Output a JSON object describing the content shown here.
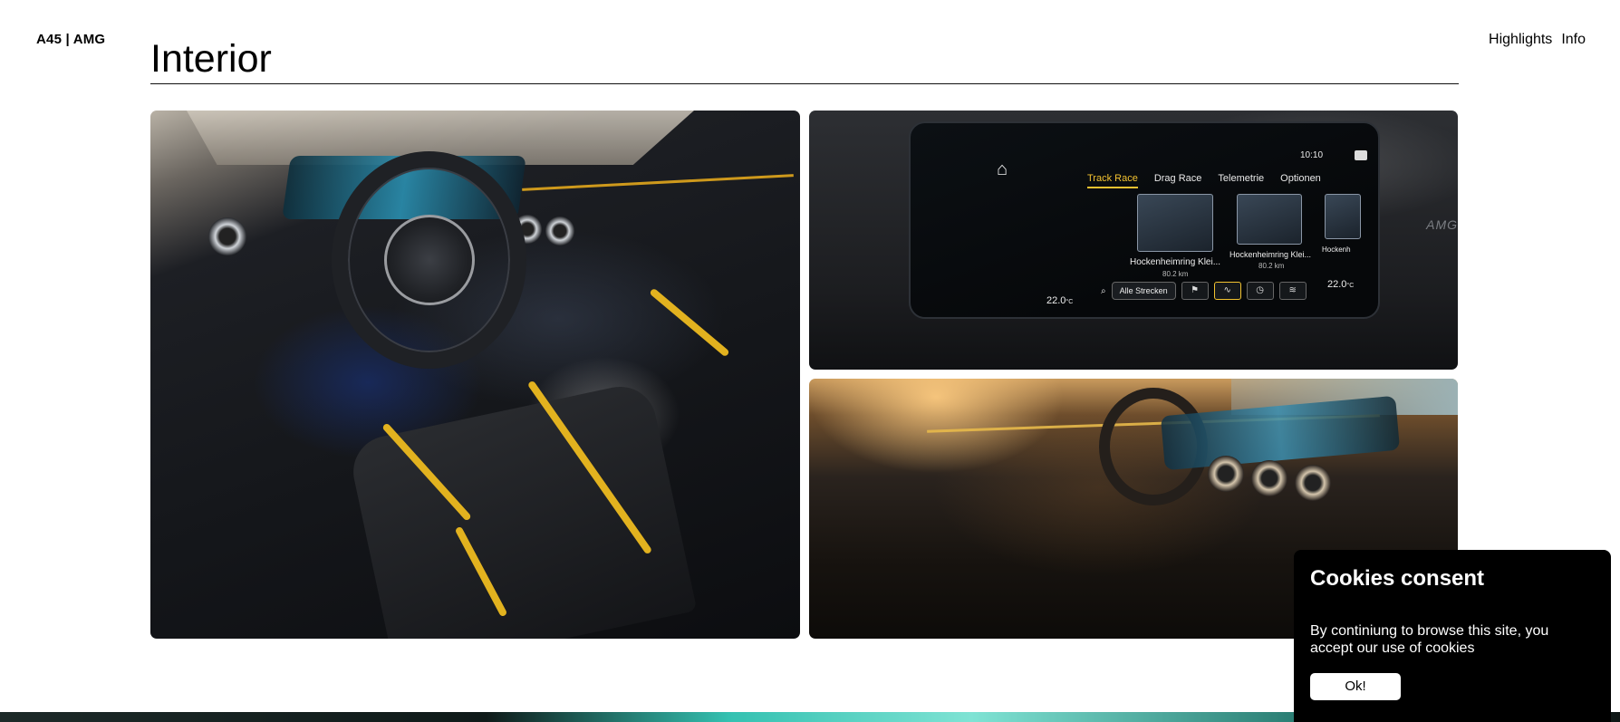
{
  "header": {
    "brand": "A45 | AMG",
    "nav": [
      "Highlights",
      "Info"
    ]
  },
  "section": {
    "title": "Interior"
  },
  "infotainment": {
    "tabs": [
      "Track Race",
      "Drag Race",
      "Telemetrie",
      "Optionen"
    ],
    "active_tab": "Track Race",
    "clock": "10:10",
    "tracks": [
      {
        "name": "Hockenheimring Klei...",
        "distance": "80.2 km"
      },
      {
        "name": "Hockenheimring Klei...",
        "distance": "80.2 km"
      },
      {
        "name": "Hockenh",
        "distance": ""
      }
    ],
    "search_label": "Alle Strecken",
    "temp_left": "22.0",
    "temp_right": "22.0",
    "temp_unit": "°C",
    "badge": "AMG"
  },
  "cookie": {
    "title": "Cookies consent",
    "text": "By continiung to browse this site, you accept our use of cookies",
    "ok_label": "Ok!"
  },
  "colors": {
    "accent_yellow": "#e2b21f",
    "cookie_bg": "#000000",
    "footer_teal": "#34c1b1"
  },
  "icons": [
    "home-icon",
    "search-icon",
    "flag-icon",
    "track-icon",
    "message-icon"
  ]
}
